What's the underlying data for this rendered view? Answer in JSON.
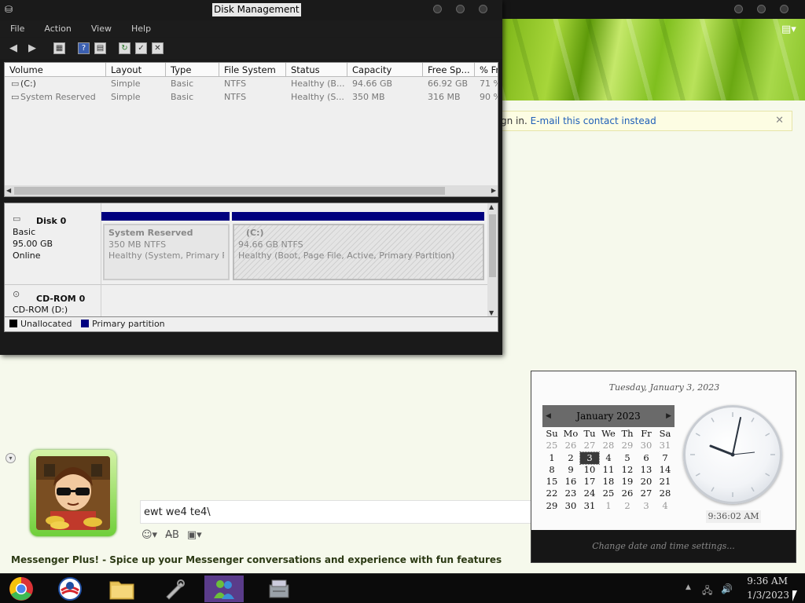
{
  "disk_management": {
    "title": "Disk Management",
    "menu": [
      "File",
      "Action",
      "View",
      "Help"
    ],
    "columns": [
      "Volume",
      "Layout",
      "Type",
      "File System",
      "Status",
      "Capacity",
      "Free Sp...",
      "% Fre"
    ],
    "volumes": [
      {
        "volume": "(C:)",
        "layout": "Simple",
        "type": "Basic",
        "fs": "NTFS",
        "status": "Healthy (B...",
        "capacity": "94.66 GB",
        "free": "66.92 GB",
        "pct": "71 %"
      },
      {
        "volume": "System Reserved",
        "layout": "Simple",
        "type": "Basic",
        "fs": "NTFS",
        "status": "Healthy (S...",
        "capacity": "350 MB",
        "free": "316 MB",
        "pct": "90 %"
      }
    ],
    "disks": [
      {
        "name": "Disk 0",
        "type": "Basic",
        "size": "95.00 GB",
        "state": "Online"
      },
      {
        "name": "CD-ROM 0",
        "type": "CD-ROM (D:)"
      }
    ],
    "partitions": [
      {
        "name": "System Reserved",
        "size": "350 MB NTFS",
        "status": "Healthy (System, Primary Par"
      },
      {
        "name": "(C:)",
        "size": "94.66 GB NTFS",
        "status": "Healthy (Boot, Page File, Active, Primary Partition)"
      }
    ],
    "legend": {
      "unallocated": "Unallocated",
      "primary": "Primary partition"
    }
  },
  "messenger": {
    "notice_prefix": "gn in.",
    "notice_link": "E-mail this contact instead",
    "input_text": "ewt we4 te4\\",
    "promo": "Messenger Plus! - Spice up your Messenger conversations and experience with fun features"
  },
  "calendar": {
    "long_date": "Tuesday, January 3, 2023",
    "month_label": "January 2023",
    "weekdays": [
      "Su",
      "Mo",
      "Tu",
      "We",
      "Th",
      "Fr",
      "Sa"
    ],
    "weeks": [
      [
        "25",
        "26",
        "27",
        "28",
        "29",
        "30",
        "31"
      ],
      [
        "1",
        "2",
        "3",
        "4",
        "5",
        "6",
        "7"
      ],
      [
        "8",
        "9",
        "10",
        "11",
        "12",
        "13",
        "14"
      ],
      [
        "15",
        "16",
        "17",
        "18",
        "19",
        "20",
        "21"
      ],
      [
        "22",
        "23",
        "24",
        "25",
        "26",
        "27",
        "28"
      ],
      [
        "29",
        "30",
        "31",
        "1",
        "2",
        "3",
        "4"
      ]
    ],
    "today": "3",
    "clock_time": "9:36:02 AM",
    "footer_link": "Change date and time settings..."
  },
  "taskbar": {
    "time": "9:36 AM",
    "date": "1/3/2023"
  }
}
